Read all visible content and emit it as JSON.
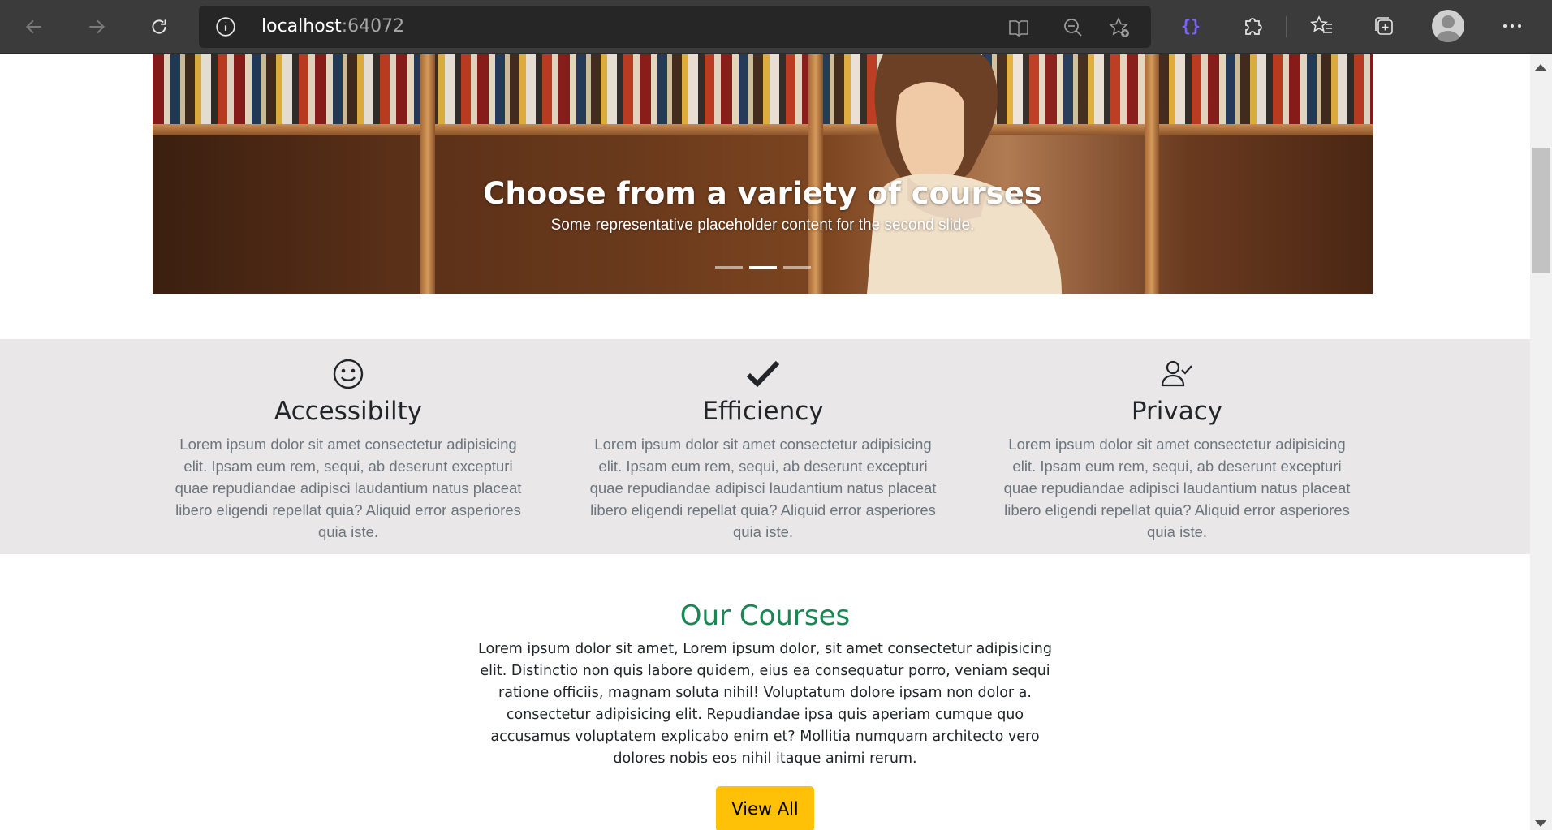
{
  "browser": {
    "url_host": "localhost",
    "url_port": ":64072",
    "icons": {
      "back": "back-arrow-icon",
      "forward": "forward-arrow-icon",
      "refresh": "refresh-icon",
      "info": "info-icon",
      "read_aloud": "immersive-reader-icon",
      "zoom": "zoom-out-icon",
      "favorite": "add-favorite-icon",
      "extension": "devtools-extension-icon",
      "extensions": "puzzle-piece-icon",
      "favorites": "favorites-icon",
      "collections": "collections-icon",
      "profile": "profile-avatar-icon",
      "more": "more-menu-icon"
    },
    "accent": "#7b61ff"
  },
  "carousel": {
    "title": "Choose from a variety of courses",
    "subtitle": "Some representative placeholder content for the second slide.",
    "slide_count": 3,
    "active_slide": 2
  },
  "features": [
    {
      "icon": "smiley-icon",
      "title": "Accessibilty",
      "text": "Lorem ipsum dolor sit amet consectetur adipisicing elit. Ipsam eum rem, sequi, ab deserunt excepturi quae repudiandae adipisci laudantium natus placeat libero eligendi repellat quia? Aliquid error asperiores quia iste."
    },
    {
      "icon": "checkmark-icon",
      "title": "Efficiency",
      "text": "Lorem ipsum dolor sit amet consectetur adipisicing elit. Ipsam eum rem, sequi, ab deserunt excepturi quae repudiandae adipisci laudantium natus placeat libero eligendi repellat quia? Aliquid error asperiores quia iste."
    },
    {
      "icon": "person-check-icon",
      "title": "Privacy",
      "text": "Lorem ipsum dolor sit amet consectetur adipisicing elit. Ipsam eum rem, sequi, ab deserunt excepturi quae repudiandae adipisci laudantium natus placeat libero eligendi repellat quia? Aliquid error asperiores quia iste."
    }
  ],
  "courses": {
    "title": "Our Courses",
    "description": "Lorem ipsum dolor sit amet, Lorem ipsum dolor, sit amet consectetur adipisicing elit. Distinctio non quis labore quidem, eius ea consequatur porro, veniam sequi ratione officiis, magnam soluta nihil! Voluptatum dolore ipsam non dolor a. consectetur adipisicing elit. Repudiandae ipsa quis aperiam cumque quo accusamus voluptatem explicabo enim et? Mollitia numquam architecto vero dolores nobis eos nihil itaque animi rerum.",
    "button_label": "View All"
  },
  "colors": {
    "courses_title": "#198754",
    "button": "#ffc107",
    "features_bg": "#e9e7e7"
  }
}
